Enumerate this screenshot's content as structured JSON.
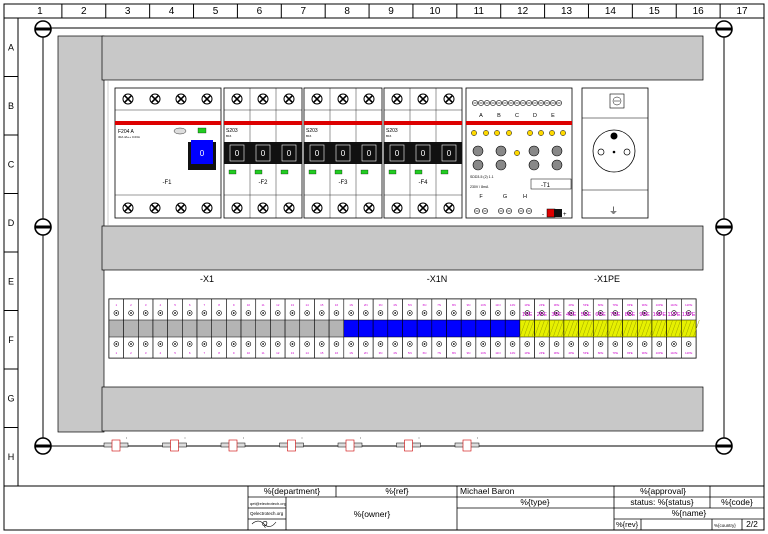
{
  "grid": {
    "columns": [
      "1",
      "2",
      "3",
      "4",
      "5",
      "6",
      "7",
      "8",
      "9",
      "10",
      "11",
      "12",
      "13",
      "14",
      "15",
      "16",
      "17"
    ],
    "rows": [
      "A",
      "B",
      "C",
      "D",
      "E",
      "F",
      "G",
      "H"
    ]
  },
  "modules": {
    "f1": {
      "label": "-F1",
      "model": "F204 A",
      "spec": "30A 4A++ 0.03A",
      "toggle": "0"
    },
    "f2": {
      "label": "-F2",
      "model": "S203",
      "spec": "B16",
      "toggles": [
        "0",
        "0",
        "0"
      ]
    },
    "f3": {
      "label": "-F3",
      "model": "S203",
      "spec": "B16",
      "toggles": [
        "0",
        "0",
        "0"
      ]
    },
    "f4": {
      "label": "-F4",
      "model": "S203",
      "spec": "B16",
      "toggles": [
        "0",
        "0",
        "0"
      ]
    },
    "t1": {
      "label": "-T1",
      "top_letters": [
        "A",
        "B",
        "C",
        "D",
        "E"
      ],
      "bottom_letters": [
        "F",
        "G",
        "H"
      ],
      "model": "SDD3-5 (2) 1.1",
      "spec": "230V / 8mA"
    }
  },
  "terminals": {
    "x1": {
      "label": "-X1",
      "count": 16,
      "numbers": [
        "1",
        "2",
        "3",
        "4",
        "5",
        "6",
        "7",
        "8",
        "9",
        "10",
        "11",
        "12",
        "13",
        "14",
        "15",
        "16"
      ]
    },
    "x1n": {
      "label": "-X1N",
      "count": 12,
      "numbers": [
        "1N",
        "2N",
        "3N",
        "4N",
        "5N",
        "6N",
        "7N",
        "8N",
        "9N",
        "10N",
        "11N",
        "12N"
      ]
    },
    "x1pe": {
      "label": "-X1PE",
      "count": 12,
      "numbers": [
        "1PE",
        "2PE",
        "3PE",
        "4PE",
        "5PE",
        "6PE",
        "7PE",
        "8PE",
        "9PE",
        "10PE",
        "11PE",
        "12PE"
      ]
    }
  },
  "title_block": {
    "department": "%{department}",
    "ref": "%{ref}",
    "author": "Michael Baron",
    "approval": "%{approval}",
    "status": "status: %{status}",
    "code": "%{code}",
    "type": "%{type}",
    "owner": "%{owner}",
    "name": "%{name}",
    "rev": "%{rev}",
    "country": "%{country}",
    "page": "2/2",
    "email": "qet@electrotech.org",
    "company": "Qelectrotech.org"
  },
  "colors": {
    "neutral_blue": "#0000ff",
    "pe_yellow": "#e6f000",
    "breaker_red": "#dd0000",
    "led_green": "#22cc22",
    "rail_gray": "#c8c8c8",
    "label_magenta": "#cc00cc"
  }
}
